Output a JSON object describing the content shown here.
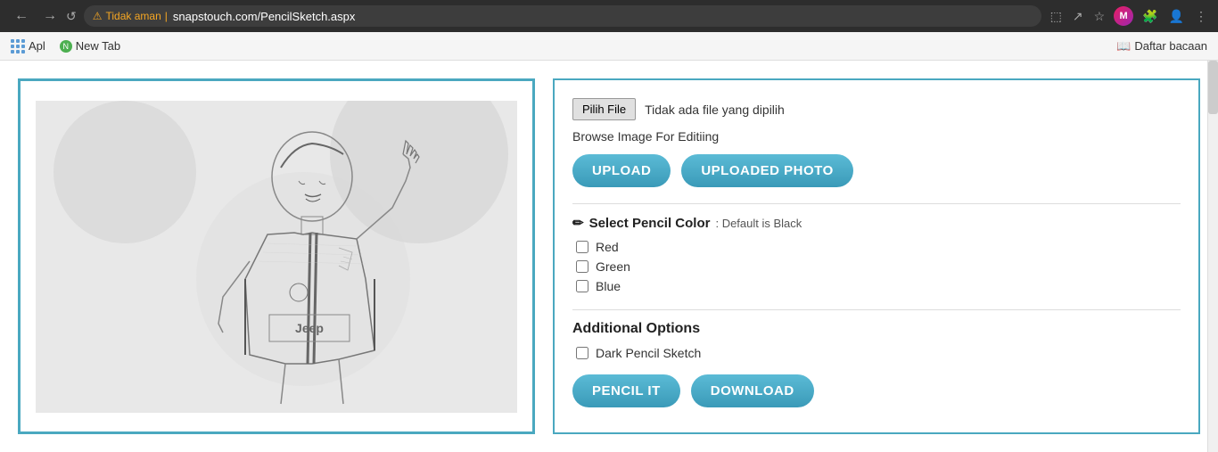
{
  "browser": {
    "back_btn": "←",
    "forward_btn": "→",
    "reload_btn": "↺",
    "security_label": "Tidak aman",
    "url": "snapstouch.com/PencilSketch.aspx",
    "translate_icon": "⊞",
    "share_icon": "↗",
    "bookmark_icon": "☆",
    "extension_icon": "🧩",
    "menu_icon": "⋮",
    "avatar_label": "M",
    "reading_list_label": "Daftar bacaan",
    "reading_list_icon": "📖"
  },
  "bookmarks": {
    "apps_label": "Apl",
    "new_tab_label": "New Tab"
  },
  "controls": {
    "choose_file_btn": "Pilih File",
    "no_file_text": "Tidak ada file yang dipilih",
    "browse_label": "Browse Image For Editiing",
    "upload_btn": "UPLOAD",
    "uploaded_photo_btn": "UPLOADED PHOTO",
    "pencil_color_label": "Select Pencil Color",
    "pencil_color_default": ": Default is Black",
    "pencil_icon": "✏",
    "color_red": "Red",
    "color_green": "Green",
    "color_blue": "Blue",
    "additional_options_label": "Additional Options",
    "dark_pencil_label": "Dark Pencil Sketch",
    "pencil_it_btn": "PENCIL IT",
    "download_btn": "DOWNLOAD"
  },
  "colors": {
    "teal": "#3a9ab8",
    "teal_light": "#5bbbd6",
    "border": "#4aa8c0"
  }
}
